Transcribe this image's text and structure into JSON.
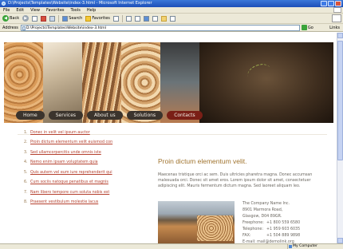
{
  "window": {
    "title": "D:\\Projects\\Templates\\Website\\index-3.html - Microsoft Internet Explorer"
  },
  "menu": [
    "File",
    "Edit",
    "View",
    "Favorites",
    "Tools",
    "Help"
  ],
  "toolbar": {
    "back_label": "Back",
    "search_label": "Search",
    "favorites_label": "Favorites"
  },
  "addressbar": {
    "label": "Address",
    "value": "D:\\Projects\\Templates\\Website\\index-3.html",
    "go_label": "Go",
    "links_label": "Links"
  },
  "nav": [
    "Home",
    "Services",
    "About us",
    "Solutions",
    "Contacts"
  ],
  "side_list": [
    {
      "num": "1.",
      "label": "Donec in velit vel ipsum auctor"
    },
    {
      "num": "2.",
      "label": "Proin dictum elementum velit euismod con"
    },
    {
      "num": "3.",
      "label": "Sed ullamcorpercitis unde omnis iste"
    },
    {
      "num": "4.",
      "label": "Nemo enim ipsam voluptatem quia"
    },
    {
      "num": "5.",
      "label": "Quis autem vel eum iure reprehenderit qui"
    },
    {
      "num": "6.",
      "label": "Cum sociis natoque penatibus et magnis"
    },
    {
      "num": "7.",
      "label": "Nam libero tempore cum soluta nobis est"
    },
    {
      "num": "8.",
      "label": "Praesent vestibulum molestie lacus"
    }
  ],
  "main": {
    "title": "Proin dictum elementum velit.",
    "paragraph": "Maecenas tristique orci ac sem. Duis ultricies pharetra magna. Donec accumsan malesuada orci. Donec sit amet eros. Lorem ipsum dolor sit amet, consectetuer adipiscing elit. Mauris fermentum dictum magna. Sed laoreet aliquam leo."
  },
  "address": {
    "company": "The Company Name Inc.",
    "street": "8901 Marmora Road,",
    "city": "Glasgow, D04 89GR.",
    "rows": [
      {
        "k": "Freephone:",
        "v": "+1 800 559 6580"
      },
      {
        "k": "Telephone:",
        "v": "+1 959 603 6035"
      },
      {
        "k": "FAX:",
        "v": "+1 504 889 9898"
      }
    ],
    "email": "E-mail: mail@demolink.org"
  },
  "statusbar": {
    "zone": "My Computer"
  }
}
